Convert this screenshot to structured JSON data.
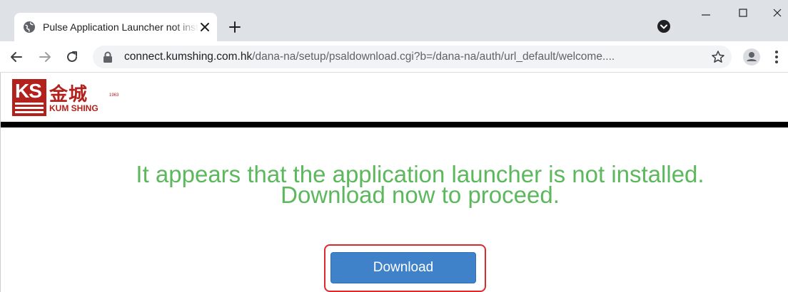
{
  "browser": {
    "tab": {
      "title": "Pulse Application Launcher not installed",
      "favicon": "globe-icon",
      "close_icon": "close-icon"
    },
    "new_tab_icon": "plus-icon",
    "window_controls": {
      "minimize": "minimize-icon",
      "maximize": "maximize-icon",
      "close": "close-icon"
    },
    "toolbar": {
      "back_icon": "arrow-left-icon",
      "forward_icon": "arrow-right-icon",
      "reload_icon": "reload-icon",
      "url_host": "connect.kumshing.com.hk",
      "url_path": "/dana-na/setup/psaldownload.cgi?b=/dana-na/auth/url_default/welcome....",
      "lock_icon": "lock-icon",
      "bookmark_icon": "star-icon",
      "profile_icon": "person-icon",
      "menu_icon": "kebab-menu-icon"
    }
  },
  "page": {
    "logo": {
      "mark": "KS",
      "chinese": "金城",
      "year": "1963",
      "english": "KUM SHING"
    },
    "message": {
      "line1": "It appears that the application launcher is not installed.",
      "line2": "Download now to proceed."
    },
    "download_button": {
      "label": "Download"
    }
  },
  "colors": {
    "message_green": "#5cb85c",
    "button_blue": "#3f82c9",
    "highlight_red": "#e0282c",
    "brand_red": "#b3211c"
  }
}
